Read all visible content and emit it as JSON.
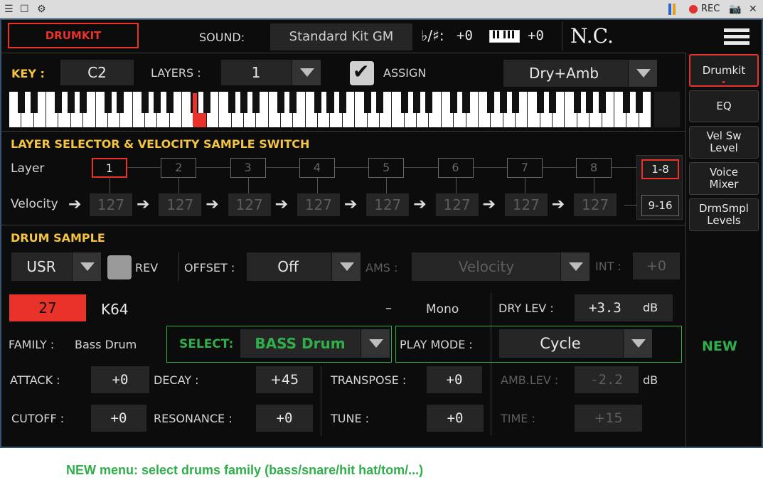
{
  "window": {
    "rec_label": "REC"
  },
  "header": {
    "drumkit_button": "DRUMKIT",
    "sound_label": "SOUND:",
    "sound_value": "Standard Kit GM",
    "flat_sharp_label": "♭/♯:",
    "flat_sharp_value": "+0",
    "keyboard_value": "+0",
    "chord_display": "N.C."
  },
  "key_row": {
    "key_label": "KEY :",
    "key_value": "C2",
    "layers_label": "LAYERS :",
    "layers_value": "1",
    "assign_label": "ASSIGN",
    "assign_checked": true,
    "mode_value": "Dry+Amb"
  },
  "layer_section": {
    "title": "LAYER SELECTOR & VELOCITY SAMPLE SWITCH",
    "layer_label": "Layer",
    "velocity_label": "Velocity",
    "layers": [
      "1",
      "2",
      "3",
      "4",
      "5",
      "6",
      "7",
      "8"
    ],
    "velocities": [
      "127",
      "127",
      "127",
      "127",
      "127",
      "127",
      "127",
      "127"
    ],
    "range_1": "1-8",
    "range_2": "9-16"
  },
  "drum_sample": {
    "title": "DRUM SAMPLE",
    "bank_value": "USR",
    "rev_label": "REV",
    "offset_label": "OFFSET :",
    "offset_value": "Off",
    "ams_label": "AMS :",
    "ams_value": "Velocity",
    "int_label": "INT :",
    "int_value": "+0",
    "sample_number": "27",
    "sample_name": "K64",
    "dash": "–",
    "mono_label": "Mono",
    "dry_lev_label": "DRY LEV :",
    "dry_lev_value": "+3.3",
    "dry_lev_unit": "dB",
    "family_label": "FAMILY :",
    "family_value": "Bass Drum",
    "select_label": "SELECT:",
    "select_value": "BASS Drum",
    "play_mode_label": "PLAY MODE :",
    "play_mode_value": "Cycle",
    "attack_label": "ATTACK :",
    "attack_value": "+0",
    "decay_label": "DECAY :",
    "decay_value": "+45",
    "transpose_label": "TRANSPOSE :",
    "transpose_value": "+0",
    "amb_lev_label": "AMB.LEV :",
    "amb_lev_value": "-2.2",
    "amb_lev_unit": "dB",
    "cutoff_label": "CUTOFF :",
    "cutoff_value": "+0",
    "resonance_label": "RESONANCE :",
    "resonance_value": "+0",
    "tune_label": "TUNE :",
    "tune_value": "+0",
    "time_label": "TIME :",
    "time_value": "+15"
  },
  "sidebar": {
    "items": [
      {
        "label": "Drumkit"
      },
      {
        "label": "EQ"
      },
      {
        "label": "Vel Sw\nLevel"
      },
      {
        "label": "Voice\nMixer"
      },
      {
        "label": "DrmSmpl\nLevels"
      }
    ],
    "new_label": "NEW"
  },
  "caption": "NEW menu: select drums family (bass/snare/hit hat/tom/...)",
  "colors": {
    "accent_red": "#e8322a",
    "green": "#2fae4a",
    "yellow": "#f4c542"
  }
}
